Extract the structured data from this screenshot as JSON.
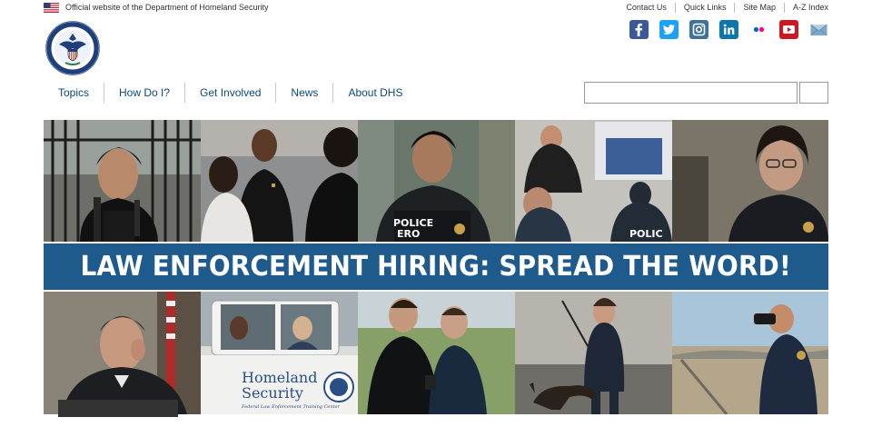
{
  "header": {
    "official_text": "Official website of the Department of Homeland Security",
    "utility_links": [
      "Contact Us",
      "Quick Links",
      "Site Map",
      "A-Z Index"
    ],
    "social_icons": [
      "facebook-icon",
      "twitter-icon",
      "instagram-icon",
      "linkedin-icon",
      "flickr-icon",
      "youtube-icon",
      "email-icon"
    ]
  },
  "nav": {
    "items": [
      "Topics",
      "How Do I?",
      "Get Involved",
      "News",
      "About DHS"
    ]
  },
  "search": {
    "placeholder": "",
    "button_label": ""
  },
  "hero": {
    "banner_text": "LAW ENFORCEMENT HIRING: SPREAD THE WORD!",
    "vest_police": "POLICE",
    "vest_ero": "ERO",
    "vest_polic": "POLIC",
    "truck_line1": "Homeland",
    "truck_line2": "Security",
    "truck_line3": "Federal Law Enforcement Training Center"
  },
  "colors": {
    "banner": "#1e5a8c",
    "nav_link": "#0b4a7a"
  }
}
